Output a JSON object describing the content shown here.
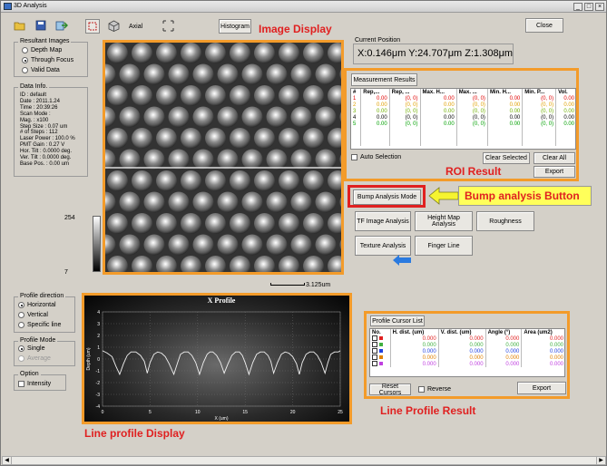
{
  "window": {
    "title": "3D Analysis",
    "close_label": "Close"
  },
  "toolbar": {
    "axial_label": "Axial",
    "histogram_label": "Histogram"
  },
  "resultant_images": {
    "title": "Resultant Images",
    "options": [
      "Depth Map",
      "Through Focus",
      "Valid Data"
    ],
    "selected": "Through Focus"
  },
  "data_info": {
    "title": "Data Info.",
    "lines": [
      "ID : default",
      "Date : 2011.1.24",
      "Time : 20:39:26",
      "Scan Mode :",
      "Mag. : x100",
      "Step Size : 0.07 um",
      "# of Steps : 112",
      "Laser Power : 100.0 %",
      "PMT Gain : 0.27 V",
      "Hor. Tilt : 0.0000 deg.",
      "Ver. Tilt : 0.0000 deg.",
      "Base Pos. : 0.00 um"
    ]
  },
  "grayscale": {
    "max": "254",
    "min": "7"
  },
  "annotations": {
    "image_display": "Image Display",
    "roi_result": "ROI  Result",
    "bump_button_label": "Bump analysis Button",
    "line_profile_display": "Line profile Display",
    "line_profile_result": "Line Profile Result"
  },
  "scale_bar": "3.125um",
  "current_position": {
    "title": "Current Position",
    "value": "X:0.146μm Y:24.707μm Z:1.308μm"
  },
  "measurement": {
    "tab": "Measurement Results",
    "headers": [
      "#",
      "Rep,...",
      "Rep, ...",
      "Max. H...",
      "Max. ...",
      "Min. H...",
      "Min. P...",
      "Vol."
    ],
    "rows": [
      {
        "n": "1",
        "c": "#e00000",
        "vals": [
          "0.00",
          "(0, 0)",
          "0.00",
          "(0, 0)",
          "0.00",
          "(0, 0)",
          "0.00"
        ]
      },
      {
        "n": "2",
        "c": "#e0a000",
        "vals": [
          "0.00",
          "(0, 0)",
          "0.00",
          "(0, 0)",
          "0.00",
          "(0, 0)",
          "0.00"
        ]
      },
      {
        "n": "3",
        "c": "#70b000",
        "vals": [
          "0.00",
          "(0, 0)",
          "0.00",
          "(0, 0)",
          "0.00",
          "(0, 0)",
          "0.00"
        ]
      },
      {
        "n": "4",
        "c": "#000000",
        "vals": [
          "0.00",
          "(0, 0)",
          "0.00",
          "(0, 0)",
          "0.00",
          "(0, 0)",
          "0.00"
        ]
      },
      {
        "n": "5",
        "c": "#00a000",
        "vals": [
          "0.00",
          "(0, 0)",
          "0.00",
          "(0, 0)",
          "0.00",
          "(0, 0)",
          "0.00"
        ]
      }
    ],
    "auto_selection": "Auto Selection",
    "clear_selected": "Clear Selected",
    "clear_all": "Clear All",
    "export": "Export"
  },
  "analysis_buttons": {
    "bump": "Bump Analysis Mode",
    "tf_image": "TF Image Analysis",
    "height_map": "Height Map Analysis",
    "roughness": "Roughness",
    "texture": "Texture Analysis",
    "finger_line": "Finger Line"
  },
  "profile_direction": {
    "title": "Profile direction",
    "options": [
      "Horizontal",
      "Vertical",
      "Specific line"
    ],
    "selected": "Horizontal"
  },
  "profile_mode": {
    "title": "Profile Mode",
    "options": [
      "Single",
      "Average"
    ],
    "selected": "Single"
  },
  "option": {
    "title": "Option",
    "intensity": "Intensity"
  },
  "x_profile": {
    "title": "X Profile",
    "ylabel": "Depth (um)",
    "xlabel": "X (um)",
    "yticks": [
      "4",
      "3",
      "2",
      "1",
      "0",
      "-1",
      "-2",
      "-3",
      "-4"
    ],
    "xticks": [
      "0",
      "5",
      "10",
      "15",
      "20",
      "25"
    ]
  },
  "chart_data": {
    "type": "line",
    "title": "X Profile",
    "xlabel": "X (um)",
    "ylabel": "Depth (um)",
    "xlim": [
      0,
      25
    ],
    "ylim": [
      -4,
      4
    ],
    "grid": true,
    "series": [
      {
        "x": [
          0,
          0.5,
          1.0,
          1.4,
          1.8,
          2.2,
          2.6,
          3.0,
          3.5,
          4.0,
          4.4,
          4.7,
          5.0,
          5.4,
          5.8,
          6.2,
          6.6,
          7.0,
          7.5,
          7.9,
          8.2,
          8.6,
          9.0,
          9.4,
          9.8,
          10.2,
          10.6,
          11.0,
          11.3,
          11.6,
          12.0,
          12.4,
          12.8,
          13.2,
          13.6,
          14.0,
          14.4,
          14.7,
          15.0,
          15.4,
          15.8,
          16.2,
          16.6,
          17.0,
          17.4,
          17.7,
          18.0,
          18.4,
          18.8,
          19.2,
          19.6,
          20.0,
          20.4,
          20.7,
          21.0,
          21.4,
          21.8,
          22.2,
          22.6,
          23.0,
          23.4,
          23.7,
          24.0,
          24.4,
          24.8,
          25.0
        ],
        "y": [
          0.7,
          0.5,
          0.2,
          -0.6,
          -1.3,
          -0.4,
          0.3,
          0.6,
          0.6,
          0.3,
          -0.2,
          -1.2,
          -0.3,
          0.4,
          0.6,
          0.5,
          0.2,
          -0.4,
          -1.3,
          -0.3,
          0.4,
          0.6,
          0.6,
          0.3,
          -0.3,
          -1.3,
          -0.3,
          0.4,
          0.6,
          0.6,
          0.3,
          -0.3,
          -1.2,
          -0.4,
          0.3,
          0.6,
          0.6,
          0.3,
          -0.3,
          -1.3,
          -0.3,
          0.4,
          0.6,
          0.6,
          0.3,
          -0.2,
          -1.2,
          -0.3,
          0.4,
          0.6,
          0.5,
          0.2,
          -0.4,
          -1.3,
          -0.3,
          0.4,
          0.6,
          0.6,
          0.3,
          -0.3,
          -1.2,
          -0.3,
          0.4,
          0.6,
          0.6,
          0.7
        ]
      }
    ]
  },
  "profile_cursor": {
    "tab": "Profile Cursor List",
    "headers": [
      "No.",
      "H. dist. (um)",
      "V. dist. (um)",
      "Angle (°)",
      "Area (um2)"
    ],
    "rows": [
      {
        "c": "#e02020",
        "vals": [
          "0.000",
          "0.000",
          "0.000",
          "0.000"
        ]
      },
      {
        "c": "#40b040",
        "vals": [
          "0.000",
          "0.000",
          "0.000",
          "0.000"
        ]
      },
      {
        "c": "#2040e0",
        "vals": [
          "0.000",
          "0.000",
          "0.000",
          "0.000"
        ]
      },
      {
        "c": "#e08000",
        "vals": [
          "0.000",
          "0.000",
          "0.000",
          "0.000"
        ]
      },
      {
        "c": "#c040e0",
        "vals": [
          "0.000",
          "0.000",
          "0.000",
          "0.000"
        ]
      }
    ],
    "reset_cursors": "Reset Cursors",
    "reverse": "Reverse",
    "export": "Export"
  }
}
